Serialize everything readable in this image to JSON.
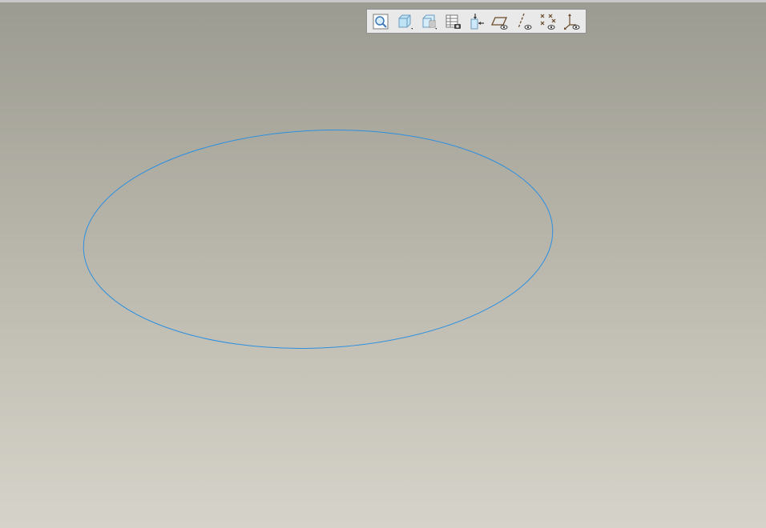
{
  "window": {
    "title": ""
  },
  "toolbar": {
    "buttons": [
      {
        "icon": "zoom-refit-icon",
        "tooltip": ""
      },
      {
        "icon": "saved-orientation-icon",
        "tooltip": ""
      },
      {
        "icon": "display-style-icon",
        "tooltip": ""
      },
      {
        "icon": "view-manager-icon",
        "tooltip": ""
      },
      {
        "icon": "sketch-view-icon",
        "tooltip": ""
      },
      {
        "icon": "plane-display-icon",
        "tooltip": ""
      },
      {
        "icon": "axis-display-icon",
        "tooltip": ""
      },
      {
        "icon": "point-display-icon",
        "tooltip": ""
      },
      {
        "icon": "csys-display-icon",
        "tooltip": ""
      }
    ]
  },
  "sketch": {
    "entities": [
      {
        "type": "ellipse",
        "color": "#2c8fe0"
      }
    ]
  },
  "colors": {
    "background_top": "#9c9b91",
    "background_bottom": "#d6d4ca",
    "sketch_line": "#2c8fe0",
    "toolbar_bg": "#e9e9e9"
  }
}
